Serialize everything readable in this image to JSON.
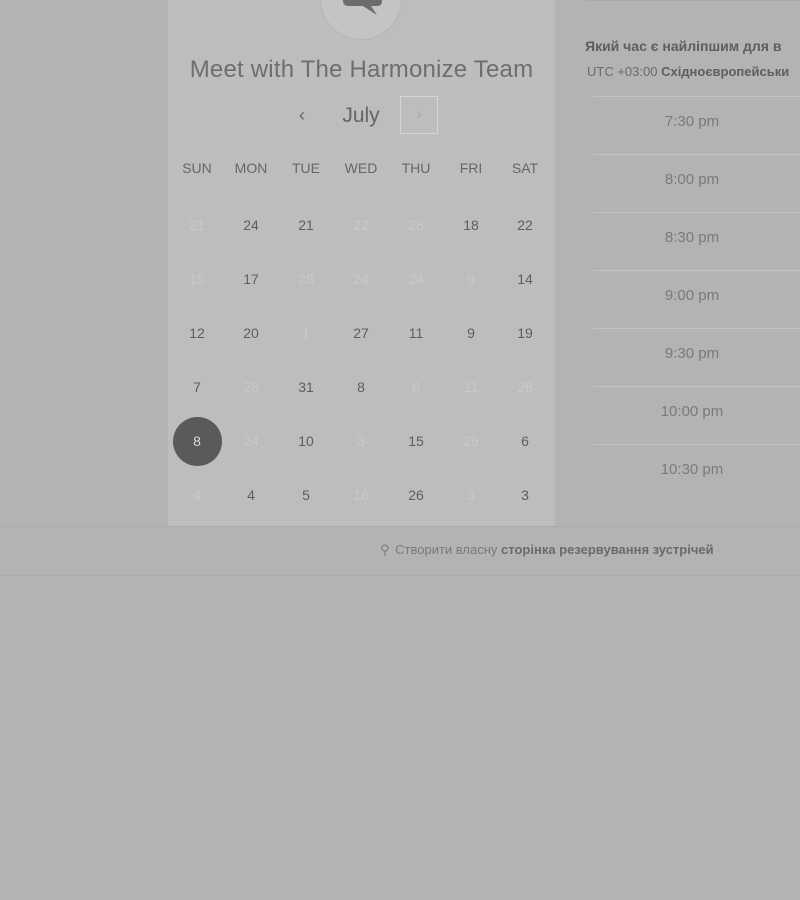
{
  "header": {
    "title": "Meet with The Harmonize Team"
  },
  "calendar": {
    "month": "July",
    "prev_icon": "‹",
    "next_icon": "›",
    "weekdays": [
      "SUN",
      "MON",
      "TUE",
      "WED",
      "THU",
      "FRI",
      "SAT"
    ],
    "weeks": [
      [
        {
          "d": "21",
          "m": true
        },
        {
          "d": "24",
          "m": false
        },
        {
          "d": "21",
          "m": false
        },
        {
          "d": "22",
          "m": true
        },
        {
          "d": "28",
          "m": true
        },
        {
          "d": "18",
          "m": false
        },
        {
          "d": "22",
          "m": false
        }
      ],
      [
        {
          "d": "15",
          "m": true
        },
        {
          "d": "17",
          "m": false
        },
        {
          "d": "28",
          "m": true
        },
        {
          "d": "24",
          "m": true
        },
        {
          "d": "24",
          "m": true
        },
        {
          "d": "9",
          "m": true
        },
        {
          "d": "14",
          "m": false
        }
      ],
      [
        {
          "d": "12",
          "m": false
        },
        {
          "d": "20",
          "m": false
        },
        {
          "d": "1",
          "m": true
        },
        {
          "d": "27",
          "m": false
        },
        {
          "d": "11",
          "m": false
        },
        {
          "d": "9",
          "m": false
        },
        {
          "d": "19",
          "m": false
        }
      ],
      [
        {
          "d": "7",
          "m": false
        },
        {
          "d": "28",
          "m": true
        },
        {
          "d": "31",
          "m": false
        },
        {
          "d": "8",
          "m": false
        },
        {
          "d": "6",
          "m": true
        },
        {
          "d": "11",
          "m": true
        },
        {
          "d": "26",
          "m": true
        }
      ],
      [
        {
          "d": "8",
          "m": false,
          "selected": true
        },
        {
          "d": "24",
          "m": true
        },
        {
          "d": "10",
          "m": false
        },
        {
          "d": "3",
          "m": true
        },
        {
          "d": "15",
          "m": false
        },
        {
          "d": "29",
          "m": true
        },
        {
          "d": "6",
          "m": false
        }
      ],
      [
        {
          "d": "4",
          "m": true
        },
        {
          "d": "4",
          "m": false
        },
        {
          "d": "5",
          "m": false
        },
        {
          "d": "16",
          "m": true
        },
        {
          "d": "26",
          "m": false
        },
        {
          "d": "3",
          "m": true
        },
        {
          "d": "3",
          "m": false
        }
      ]
    ]
  },
  "times": {
    "question": "Який час є найліпшим для в",
    "tz_prefix": "UTC +03:00",
    "tz_name": "Східноєвропейськи",
    "slots": [
      "7:30 pm",
      "8:00 pm",
      "8:30 pm",
      "9:00 pm",
      "9:30 pm",
      "10:00 pm",
      "10:30 pm"
    ]
  },
  "footer": {
    "icon": "sprocket-icon",
    "prefix": "Створити власну",
    "bold": "сторінка резервування зустрічей"
  },
  "colors": {
    "background": "#b3b3b3",
    "panel": "#bdbdbd",
    "selected_day": "#5a5a5a"
  }
}
